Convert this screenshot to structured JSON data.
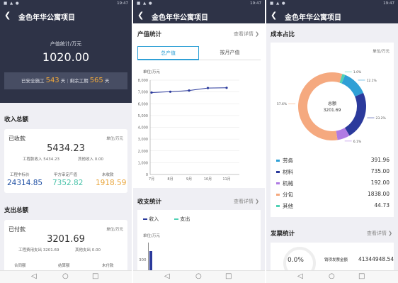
{
  "status": {
    "time": "19:47",
    "icons": "■ ▲ ●"
  },
  "nav": {
    "back": "❮",
    "title": "金色年华公寓项目"
  },
  "bottom": {
    "back": "◁",
    "home": "○",
    "recent": "□"
  },
  "panel1": {
    "output_label": "产值统计/万元",
    "output_value": "1020.00",
    "safe_prefix": "已安全施工",
    "safe_days": "543",
    "safe_unit": "天",
    "remain_prefix": "剩余工期",
    "remain_days": "565",
    "remain_unit": "天",
    "income_title": "收入总额",
    "received_label": "已收款",
    "unit": "单位/万元",
    "received_value": "5434.23",
    "project_income": "工程款收入 5434.23",
    "other_income": "其他收入 0.00",
    "bid_label": "工程中标价",
    "bid_value": "24314.85",
    "approved_label": "甲方审定产值",
    "approved_value": "7352.82",
    "unreceived_label": "未收款",
    "unreceived_value": "1918.59",
    "expense_title": "支出总额",
    "paid_label": "已付款",
    "paid_value": "3201.69",
    "project_expense": "工程费用支出 3201.69",
    "other_expense": "其他支出 0.00",
    "contract_label": "合同额",
    "settled_label": "结算额",
    "unpaid_label": "未付款"
  },
  "panel2": {
    "title": "产值统计",
    "detail": "查看详情",
    "chevron": "❯",
    "tab_total": "总产值",
    "tab_monthly": "按月产值",
    "chart_unit": "单位/万元",
    "cashflow_title": "收支统计",
    "cashflow_detail": "查看详情",
    "legend_income": "收入",
    "legend_expense": "支出",
    "cash_unit": "单位/万元",
    "cash_tick": "300"
  },
  "panel3": {
    "title": "成本占比",
    "unit": "单位/万元",
    "center_label": "总额",
    "center_value": "3201.69",
    "pct_labor": "12.1%",
    "pct_material": "23.2%",
    "pct_machine": "6.1%",
    "pct_sub": "57.6%",
    "pct_other": "1.0%",
    "items": [
      {
        "name": "劳务",
        "value": "391.96",
        "color": "#2fa0d6"
      },
      {
        "name": "材料",
        "value": "735.00",
        "color": "#2b3a9c"
      },
      {
        "name": "机械",
        "value": "192.00",
        "color": "#b07be3"
      },
      {
        "name": "分包",
        "value": "1838.00",
        "color": "#f5a97f"
      },
      {
        "name": "其他",
        "value": "44.73",
        "color": "#4fd1b4"
      }
    ],
    "invoice_title": "发票统计",
    "invoice_detail": "查看详情",
    "invoice_pct": "0.0%",
    "invoice_label": "销项发票金额",
    "invoice_value": "41344948.54"
  },
  "chart_data": [
    {
      "type": "line",
      "title": "",
      "ylabel": "单位/万元",
      "categories": [
        "7月",
        "8月",
        "9月",
        "10月",
        "11月"
      ],
      "values": [
        6950,
        7020,
        7120,
        7330,
        7350
      ],
      "ylim": [
        0,
        8000
      ],
      "yticks": [
        "0",
        "1,000",
        "2,000",
        "3,000",
        "4,000",
        "5,000",
        "6,000",
        "7,000",
        "8,000"
      ],
      "color": "#2b3a9c",
      "grid": true
    },
    {
      "type": "pie",
      "title": "",
      "labels": [
        "劳务",
        "材料",
        "机械",
        "分包",
        "其他"
      ],
      "values": [
        391.96,
        735.0,
        192.0,
        1838.0,
        44.73
      ],
      "colors": [
        "#2fa0d6",
        "#2b3a9c",
        "#b07be3",
        "#f5a97f",
        "#4fd1b4"
      ]
    }
  ]
}
